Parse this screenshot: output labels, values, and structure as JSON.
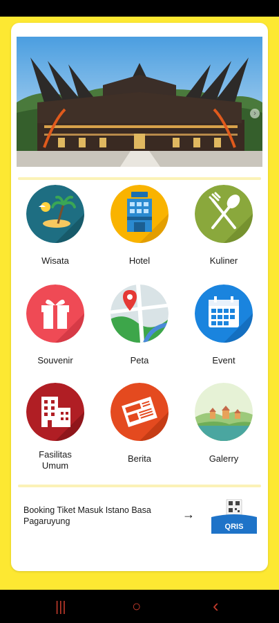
{
  "colors": {
    "background": "#FDE832",
    "card": "#FFFFFF",
    "divider": "#FBF2B7",
    "nav_icons": "#C03A2B"
  },
  "hero": {
    "image": "istano-basa-pagaruyung-photo",
    "arrow": "›"
  },
  "menu": [
    {
      "label": "Wisata",
      "icon": "beach-island-icon",
      "color": "#1E6E82"
    },
    {
      "label": "Hotel",
      "icon": "hotel-building-icon",
      "color": "#F9B300"
    },
    {
      "label": "Kuliner",
      "icon": "fork-spoon-icon",
      "color": "#8AA83C"
    },
    {
      "label": "Souvenir",
      "icon": "gift-icon",
      "color": "#EF4A55"
    },
    {
      "label": "Peta",
      "icon": "map-pin-icon",
      "color": "#D9E3E6"
    },
    {
      "label": "Event",
      "icon": "calendar-icon",
      "color": "#1A84DE"
    },
    {
      "label": "Fasilitas\nUmum",
      "icon": "building-icon",
      "color": "#B01E24"
    },
    {
      "label": "Berita",
      "icon": "newspaper-icon",
      "color": "#E44A1F"
    },
    {
      "label": "Galerry",
      "icon": "landscape-icon",
      "color": "#E6F2D6"
    }
  ],
  "booking": {
    "text": "Booking Tiket Masuk Istano Basa Pagaruyung",
    "arrow": "→",
    "badge_text": "QRIS"
  },
  "nav": {
    "recents": "|||",
    "home": "○",
    "back": "‹"
  }
}
